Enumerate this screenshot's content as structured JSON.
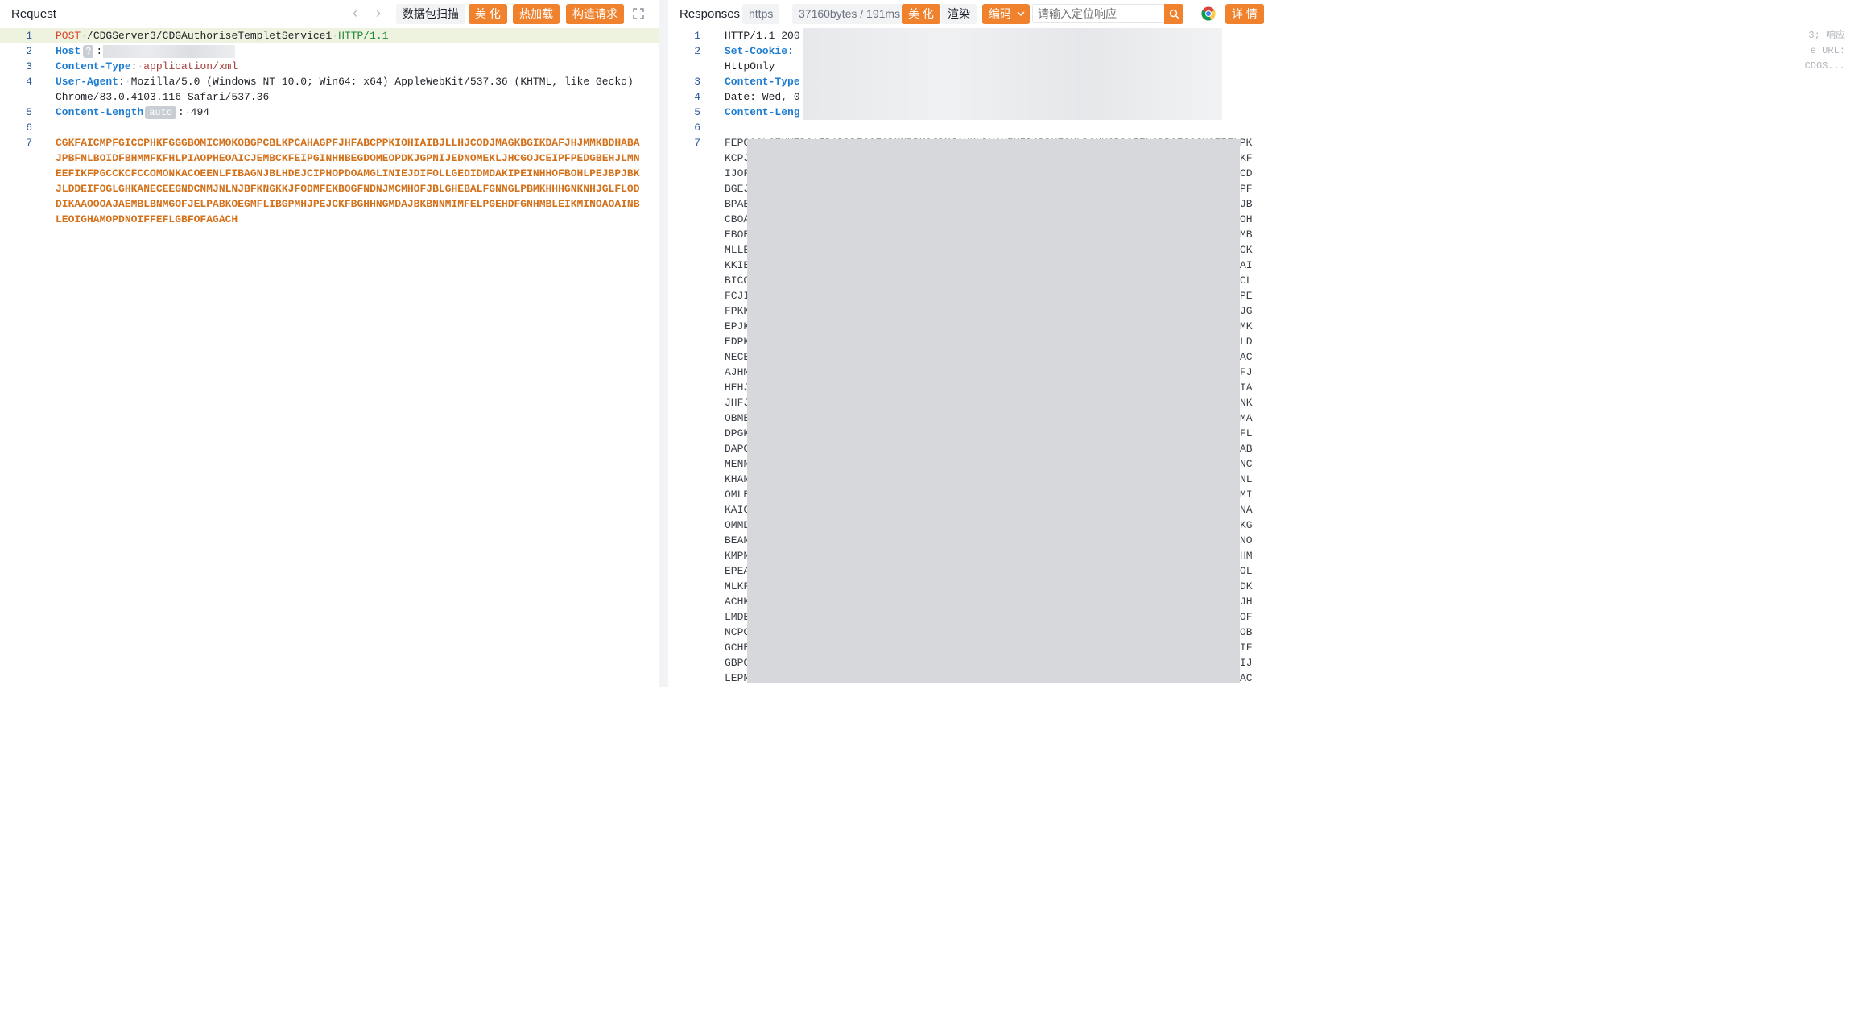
{
  "request": {
    "title": "Request",
    "buttons": {
      "scan": "数据包扫描",
      "beautify": "美 化",
      "hot_reload": "热加载",
      "construct": "构造请求"
    },
    "lines": [
      {
        "n": "1",
        "method": "POST",
        "path": "/CDGServer3/CDGAuthoriseTempletService1",
        "version": "HTTP/1.1"
      },
      {
        "n": "2",
        "key": "Host",
        "badge": "?",
        "sep": ":"
      },
      {
        "n": "3",
        "key": "Content-Type",
        "sep": ":",
        "value": "application/xml"
      },
      {
        "n": "4",
        "key": "User-Agent",
        "sep": ":",
        "value": "Mozilla/5.0 (Windows NT 10.0; Win64; x64) AppleWebKit/537.36 (KHTML, like Gecko)",
        "cont": "Chrome/83.0.4103.116 Safari/537.36"
      },
      {
        "n": "5",
        "key": "Content-Length",
        "badge": "auto",
        "sep": ":",
        "value": "494"
      },
      {
        "n": "6"
      },
      {
        "n": "7",
        "body": [
          "CGKFAICMPFGICCPHKFGGGBOMICMOKOBGPCBLKPCAHAGPFJHFABCPPKIOHIAIBJLLHJCODJMAGKBGIKDAFJHJMMKBDHABA",
          "JPBFNLBOIDFBHMMFKFHLPIAOPHEOAICJEMBCKFEIPGINHHBEGDOMEOPDKJGPNIJEDNOMEKLJHCGOJCEIPFPEDGBEHJLMN",
          "EEFIKFPGCCKCFCCOMONKACOEENLFIBAGNJBLHDEJCIPHOPDOAMGLINIEJDIFOLLGEDIDMDAKIPEINHHOFBOHLPEJBPJBK",
          "JLDDEIFOGLGHKANECEEGNDCNMJNLNJBFKNGKKJFODMFEKBOGFNDNJMCMHOFJBLGHEBALFGNNGLPBMKHHHGNKNHJGLFLOD",
          "DIKAAOOOAJAEMBLBNMGOFJELPABKOEGMFLIBGPMHJPEJCKFBGHHNGMDAJBKBNNMIMFELPGEHDFGNHMBLEIKMINOAOAINB",
          "LEOIGHAMOPDNOIFFEFLGBFOFAGACH"
        ]
      }
    ]
  },
  "response": {
    "title": "Responses",
    "protocol": "https",
    "stats": "37160bytes / 191ms",
    "buttons": {
      "beautify": "美 化",
      "render": "渲染",
      "encoding": "编码",
      "detail": "详 情"
    },
    "search_placeholder": "请输入定位响应",
    "right_snippets": {
      "l1": "3; 响应",
      "l2": "e URL:",
      "l2b": "CDGS..."
    },
    "header_lines": [
      {
        "n": "1",
        "text": "HTTP/1.1 200"
      },
      {
        "n": "2",
        "key": "Set-Cookie:",
        "cont": "HttpOnly"
      },
      {
        "n": "3",
        "key": "Content-Type"
      },
      {
        "n": "4",
        "text": "Date: Wed, 0"
      },
      {
        "n": "5",
        "key": "Content-Leng"
      },
      {
        "n": "6"
      }
    ],
    "body_first": "FEPCGCLCENUTDOAFDADDDECCFADNMDBMOJDMJAKKNDUOKIKIDCDDUECKLDCNUCBDOEENCDBCECCJNCEIELPK",
    "body_rows": [
      {
        "l": "KCPJ",
        "r": "KF"
      },
      {
        "l": "IJOF",
        "r": "CD"
      },
      {
        "l": "BGEJ",
        "r": "PF"
      },
      {
        "l": "BPAE",
        "r": "JB"
      },
      {
        "l": "CBOA",
        "r": "OH"
      },
      {
        "l": "EBOE",
        "r": "MB"
      },
      {
        "l": "MLLE",
        "r": "CK"
      },
      {
        "l": "KKIE",
        "r": "AI"
      },
      {
        "l": "BICC",
        "r": "CL"
      },
      {
        "l": "FCJI",
        "r": "PE"
      },
      {
        "l": "FPKK",
        "r": "JG"
      },
      {
        "l": "EPJK",
        "r": "MK"
      },
      {
        "l": "EDPK",
        "r": "LD"
      },
      {
        "l": "NECE",
        "r": "AC"
      },
      {
        "l": "AJHM",
        "r": "FJ"
      },
      {
        "l": "HEHJ",
        "r": "IA"
      },
      {
        "l": "JHFJ",
        "r": "NK"
      },
      {
        "l": "OBME",
        "r": "MA"
      },
      {
        "l": "DPGK",
        "r": "FL"
      },
      {
        "l": "DAPC",
        "r": "AB"
      },
      {
        "l": "MENN",
        "r": "NC"
      },
      {
        "l": "KHAN",
        "r": "NL"
      },
      {
        "l": "OMLE",
        "r": "MI"
      },
      {
        "l": "KAIC",
        "r": "NA"
      },
      {
        "l": "OMMD",
        "r": "KG"
      },
      {
        "l": "BEAN",
        "r": "NO"
      },
      {
        "l": "KMPN",
        "r": "HM"
      },
      {
        "l": "EPEA",
        "r": "OL"
      },
      {
        "l": "MLKF",
        "r": "DK"
      },
      {
        "l": "ACHK",
        "r": "JH"
      },
      {
        "l": "LMDE",
        "r": "OF"
      },
      {
        "l": "NCPC",
        "r": "OB"
      },
      {
        "l": "GCHE",
        "r": "IF"
      },
      {
        "l": "GBPC",
        "r": "IJ"
      },
      {
        "l": "LEPN",
        "r": "AC"
      }
    ]
  }
}
